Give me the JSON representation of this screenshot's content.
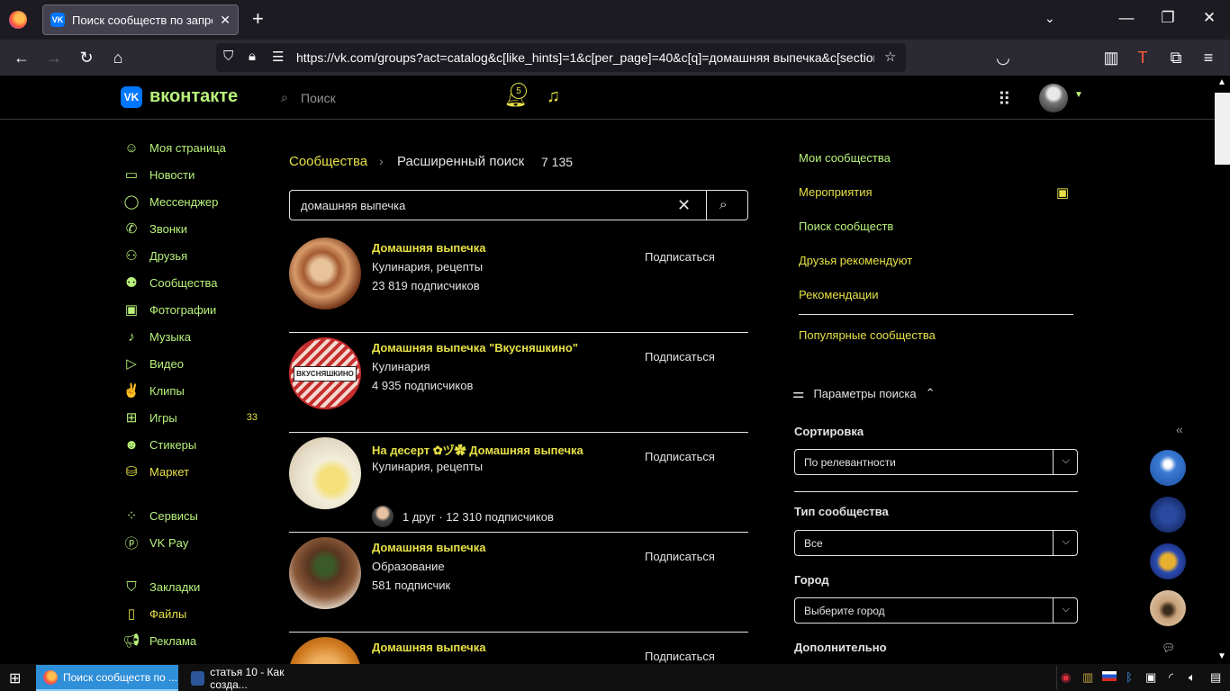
{
  "browser": {
    "tab_title": "Поиск сообществ по запросу",
    "url": "https://vk.com/groups?act=catalog&c[like_hints]=1&c[per_page]=40&c[q]=домашняя выпечка&c[section"
  },
  "header": {
    "brand": "вконтакте",
    "search_placeholder": "Поиск",
    "notifications_count": "5"
  },
  "menu": {
    "items": [
      {
        "label": "Моя страница",
        "icon": "user-circle-icon"
      },
      {
        "label": "Новости",
        "icon": "news-icon"
      },
      {
        "label": "Мессенджер",
        "icon": "message-icon"
      },
      {
        "label": "Звонки",
        "icon": "phone-icon"
      },
      {
        "label": "Друзья",
        "icon": "friends-icon"
      },
      {
        "label": "Сообщества",
        "icon": "communities-icon"
      },
      {
        "label": "Фотографии",
        "icon": "photo-icon"
      },
      {
        "label": "Музыка",
        "icon": "music-icon"
      },
      {
        "label": "Видео",
        "icon": "video-icon"
      },
      {
        "label": "Клипы",
        "icon": "clips-icon"
      },
      {
        "label": "Игры",
        "icon": "gamepad-icon",
        "count": "33"
      },
      {
        "label": "Стикеры",
        "icon": "smile-icon"
      },
      {
        "label": "Маркет",
        "icon": "bag-icon"
      },
      {
        "label": "Сервисы",
        "icon": "services-icon"
      },
      {
        "label": "VK Pay",
        "icon": "pay-icon"
      },
      {
        "label": "Закладки",
        "icon": "bookmark-icon"
      },
      {
        "label": "Файлы",
        "icon": "file-icon"
      },
      {
        "label": "Реклама",
        "icon": "megaphone-icon"
      }
    ]
  },
  "main": {
    "breadcrumb_root": "Сообщества",
    "breadcrumb_current": "Расширенный поиск",
    "result_count": "7 135",
    "search_value": "домашняя выпечка",
    "join_label": "Подписаться",
    "results": [
      {
        "name": "Домашняя выпечка",
        "category": "Кулинария, рецепты",
        "subscribers": "23 819 подписчиков"
      },
      {
        "name": "Домашняя выпечка \"Вкусняшкино\"",
        "category": "Кулинария",
        "subscribers": "4 935 подписчиков"
      },
      {
        "name": "На десерт ✿ヅ✿ Домашняя выпечка",
        "category": "Кулинария, рецепты",
        "subscribers": "1 друг · 12 310 подписчиков"
      },
      {
        "name": "Домашняя выпечка",
        "category": "Образование",
        "subscribers": "581 подписчик"
      },
      {
        "name": "Домашняя выпечка",
        "category": "",
        "subscribers": ""
      }
    ]
  },
  "right_nav": {
    "items": [
      "Мои сообщества",
      "Мероприятия",
      "Поиск сообществ",
      "Друзья рекомендуют",
      "Рекомендации",
      "Популярные сообщества"
    ]
  },
  "filters": {
    "title": "Параметры поиска",
    "sort_label": "Сортировка",
    "sort_value": "По релевантности",
    "type_label": "Тип сообщества",
    "type_value": "Все",
    "city_label": "Город",
    "city_value": "Выберите город",
    "extra_label": "Дополнительно"
  },
  "taskbar": {
    "items": [
      "Поиск сообществ по ...",
      "статья 10 - Как созда..."
    ]
  },
  "colors": {
    "accent_yellow": "#e6e046",
    "accent_green": "#b8f27a",
    "vk_blue": "#0077ff"
  }
}
